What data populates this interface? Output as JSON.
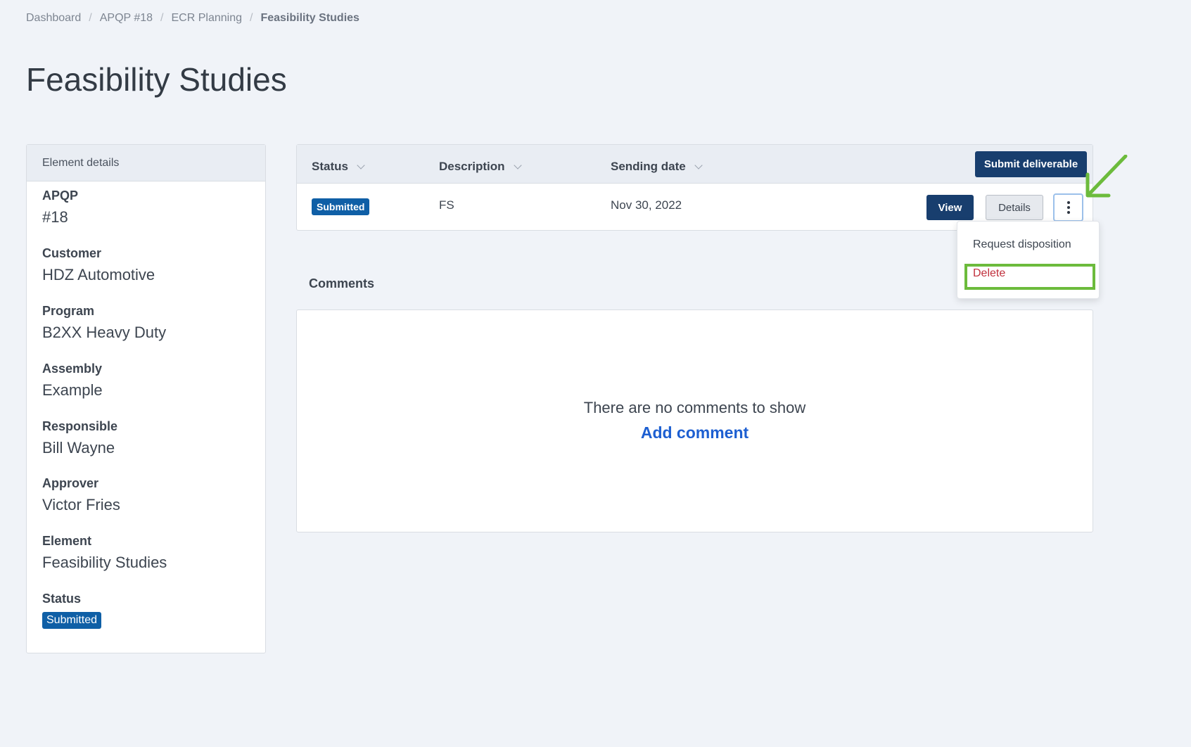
{
  "breadcrumb": [
    "Dashboard",
    "APQP #18",
    "ECR Planning",
    "Feasibility Studies"
  ],
  "page_title": "Feasibility Studies",
  "element_details": {
    "header": "Element details",
    "fields": [
      {
        "label": "APQP",
        "value": "#18"
      },
      {
        "label": "Customer",
        "value": "HDZ Automotive"
      },
      {
        "label": "Program",
        "value": "B2XX Heavy Duty"
      },
      {
        "label": "Assembly",
        "value": "Example"
      },
      {
        "label": "Responsible",
        "value": "Bill Wayne"
      },
      {
        "label": "Approver",
        "value": "Victor Fries"
      },
      {
        "label": "Element",
        "value": "Feasibility Studies"
      }
    ],
    "status_label": "Status",
    "status_value": "Submitted"
  },
  "table": {
    "columns": [
      "Status",
      "Description",
      "Sending date"
    ],
    "submit_label": "Submit deliverable",
    "rows": [
      {
        "status": "Submitted",
        "description": "FS",
        "sending_date": "Nov 30, 2022"
      }
    ],
    "view_label": "View",
    "details_label": "Details"
  },
  "dropdown": {
    "items": [
      "Request disposition",
      "Delete"
    ]
  },
  "comments": {
    "title": "Comments",
    "empty_text": "There are no comments to show",
    "add_label": "Add comment"
  },
  "colors": {
    "primary": "#183e6e",
    "badge": "#0f5fa6",
    "highlight": "#6cbb3c",
    "delete": "#c0303c",
    "link": "#1d5fd1"
  }
}
